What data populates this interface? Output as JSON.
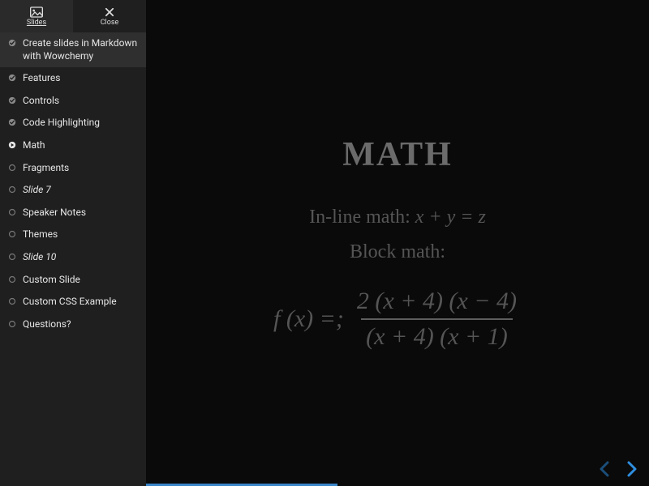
{
  "sidebar": {
    "top": {
      "slides_label": "Slides",
      "close_label": "Close"
    },
    "items": [
      {
        "label": "Create slides in Markdown with Wowchemy",
        "status": "done",
        "selected": true,
        "italic": false
      },
      {
        "label": "Features",
        "status": "done",
        "selected": false,
        "italic": false
      },
      {
        "label": "Controls",
        "status": "done",
        "selected": false,
        "italic": false
      },
      {
        "label": "Code Highlighting",
        "status": "done",
        "selected": false,
        "italic": false
      },
      {
        "label": "Math",
        "status": "current",
        "selected": false,
        "italic": false
      },
      {
        "label": "Fragments",
        "status": "todo",
        "selected": false,
        "italic": false
      },
      {
        "label": "Slide 7",
        "status": "todo",
        "selected": false,
        "italic": true
      },
      {
        "label": "Speaker Notes",
        "status": "todo",
        "selected": false,
        "italic": false
      },
      {
        "label": "Themes",
        "status": "todo",
        "selected": false,
        "italic": false
      },
      {
        "label": "Slide 10",
        "status": "todo",
        "selected": false,
        "italic": true
      },
      {
        "label": "Custom Slide",
        "status": "todo",
        "selected": false,
        "italic": false
      },
      {
        "label": "Custom CSS Example",
        "status": "todo",
        "selected": false,
        "italic": false
      },
      {
        "label": "Questions?",
        "status": "todo",
        "selected": false,
        "italic": false
      }
    ]
  },
  "slide": {
    "title": "MATH",
    "inline_prefix": "In-line math: ",
    "inline_math": "x + y = z",
    "block_label": "Block math:",
    "equation": {
      "lhs": "f (x) =;",
      "numerator": "2 (x + 4) (x − 4)",
      "denominator": "(x + 4) (x + 1)"
    }
  },
  "progress_percent": 38
}
